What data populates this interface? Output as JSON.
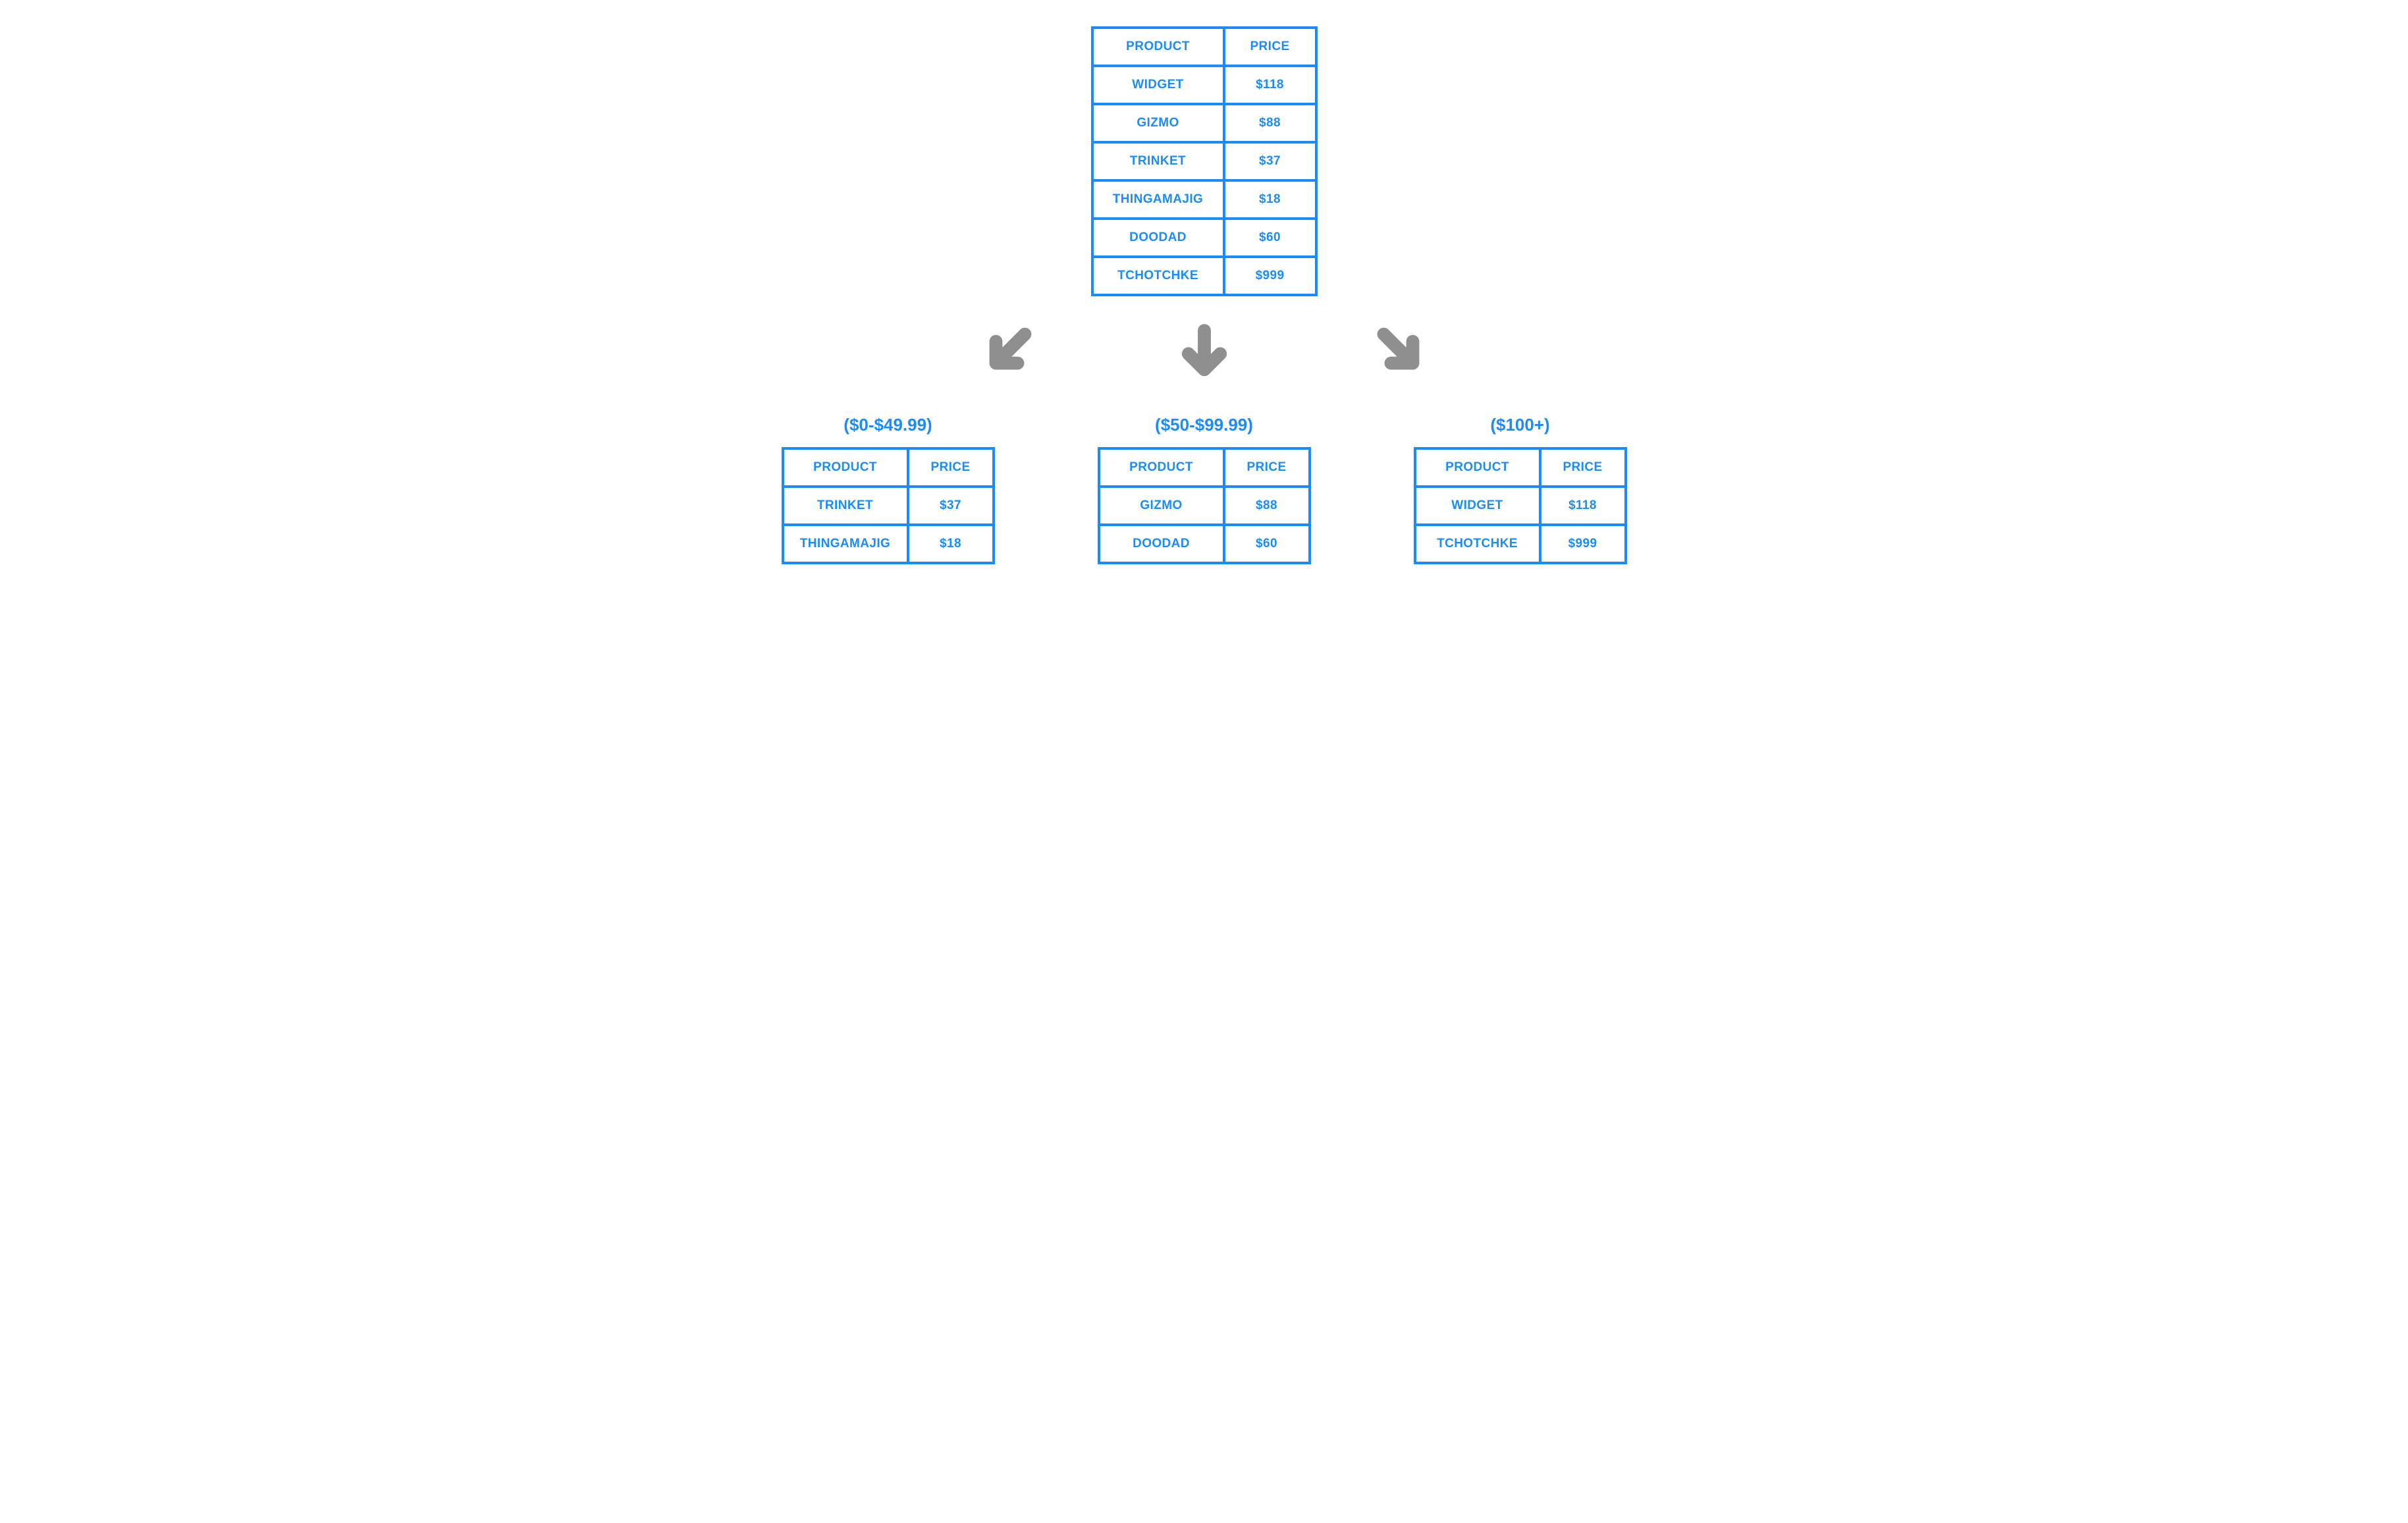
{
  "colors": {
    "line": "#1a8cff",
    "arrow": "#8f8f8f"
  },
  "columns": {
    "product": "PRODUCT",
    "price": "PRICE"
  },
  "main_table": {
    "rows": [
      {
        "product": "WIDGET",
        "price": "$118"
      },
      {
        "product": "GIZMO",
        "price": "$88"
      },
      {
        "product": "TRINKET",
        "price": "$37"
      },
      {
        "product": "THINGAMAJIG",
        "price": "$18"
      },
      {
        "product": "DOODAD",
        "price": "$60"
      },
      {
        "product": "TCHOTCHKE",
        "price": "$999"
      }
    ]
  },
  "buckets": [
    {
      "label": "($0-$49.99)",
      "rows": [
        {
          "product": "TRINKET",
          "price": "$37"
        },
        {
          "product": "THINGAMAJIG",
          "price": "$18"
        }
      ]
    },
    {
      "label": "($50-$99.99)",
      "rows": [
        {
          "product": "GIZMO",
          "price": "$88"
        },
        {
          "product": "DOODAD",
          "price": "$60"
        }
      ]
    },
    {
      "label": "($100+)",
      "rows": [
        {
          "product": "WIDGET",
          "price": "$118"
        },
        {
          "product": "TCHOTCHKE",
          "price": "$999"
        }
      ]
    }
  ],
  "chart_data": {
    "type": "table",
    "description": "Price-bucketing diagram: a source product/price table split into three price-range buckets.",
    "source": [
      {
        "product": "WIDGET",
        "price": 118
      },
      {
        "product": "GIZMO",
        "price": 88
      },
      {
        "product": "TRINKET",
        "price": 37
      },
      {
        "product": "THINGAMAJIG",
        "price": 18
      },
      {
        "product": "DOODAD",
        "price": 60
      },
      {
        "product": "TCHOTCHKE",
        "price": 999
      }
    ],
    "buckets": [
      {
        "range": "$0-$49.99",
        "min": 0,
        "max": 49.99,
        "items": [
          "TRINKET",
          "THINGAMAJIG"
        ]
      },
      {
        "range": "$50-$99.99",
        "min": 50,
        "max": 99.99,
        "items": [
          "GIZMO",
          "DOODAD"
        ]
      },
      {
        "range": "$100+",
        "min": 100,
        "max": null,
        "items": [
          "WIDGET",
          "TCHOTCHKE"
        ]
      }
    ]
  }
}
